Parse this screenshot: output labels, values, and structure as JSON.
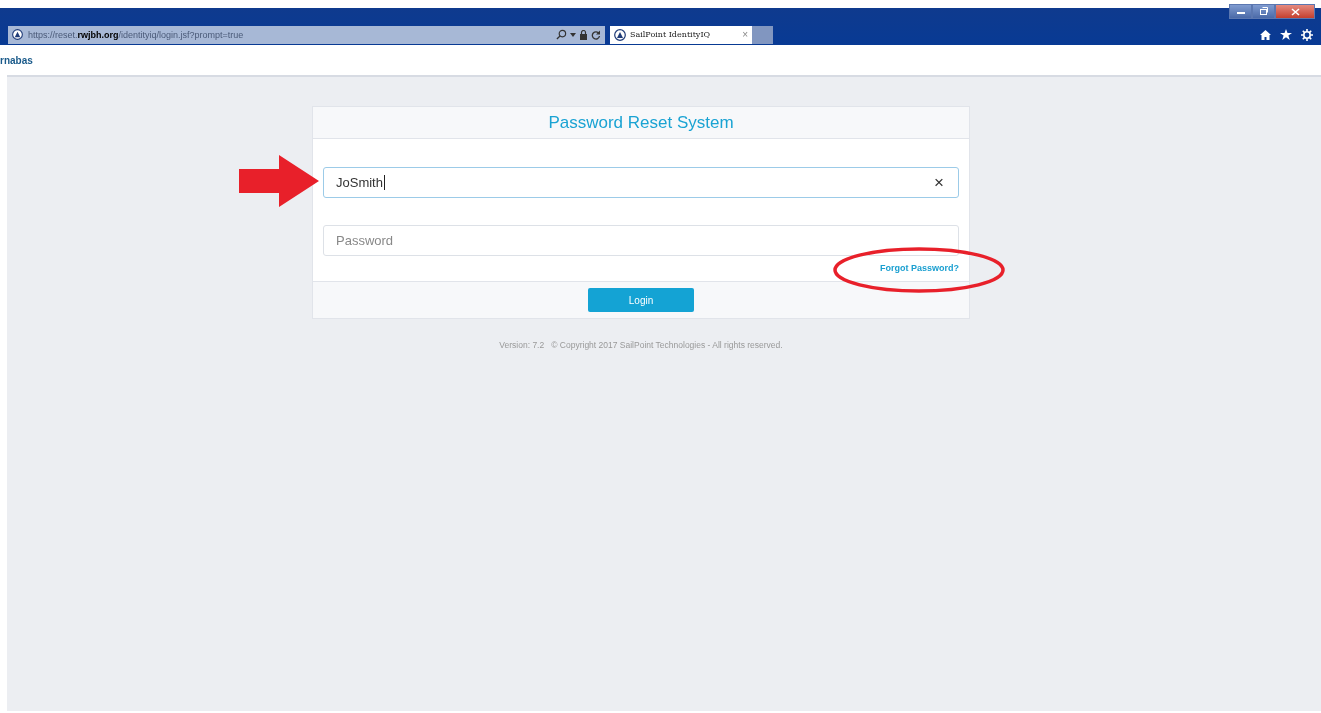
{
  "browser": {
    "address": "https://reset.**rwjbh.org**/identityiq/login.jsf?prompt=true",
    "tab_title": "SailPoint IdentityIQ",
    "tab_close": "×"
  },
  "site_header": {
    "logo_text": "rnabas"
  },
  "login_form": {
    "title": "Password Reset System",
    "username": {
      "value": "JoSmith",
      "clear": "×"
    },
    "password": {
      "placeholder": "Password"
    },
    "forgot_link": "Forgot Password?",
    "login_button": "Login"
  },
  "footer": {
    "version": "Version: 7.2",
    "copyright": "© Copyright 2017 SailPoint Technologies - All rights reserved."
  }
}
